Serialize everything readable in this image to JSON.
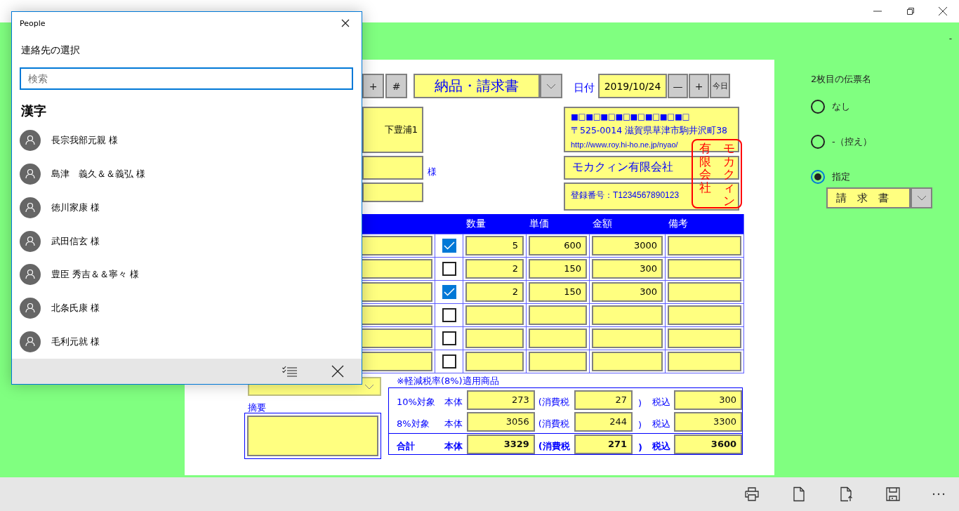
{
  "header_mark": "-",
  "sheet": {
    "toolbar": {
      "left_buttons": [
        "+",
        "#"
      ],
      "slip_type": "納品・請求書",
      "date_label": "日付",
      "date": "2019/10/24",
      "date_buttons": [
        "—",
        "+",
        "今日"
      ]
    },
    "customer": {
      "address": "下豊浦1",
      "honorific": "様"
    },
    "issuer": {
      "pattern": "■□■□■□■□■□■□■□■□",
      "address": "〒525-0014 滋賀県草津市駒井沢町38",
      "url": "http://www.roy.hi-ho.ne.jp/nyao/",
      "company": "モカクィン有限会社",
      "registration": "登録番号：T1234567890123"
    },
    "stamp": {
      "columns": [
        "有限会社",
        "モカクィン"
      ]
    },
    "table": {
      "columns": [
        "数量",
        "単価",
        "金額",
        "備考"
      ],
      "rows": [
        {
          "reduced": true,
          "qty": "5",
          "price": "600",
          "amount": "3000"
        },
        {
          "reduced": false,
          "qty": "2",
          "price": "150",
          "amount": "300"
        },
        {
          "reduced": true,
          "qty": "2",
          "price": "150",
          "amount": "300"
        },
        {
          "reduced": false
        },
        {
          "reduced": false
        },
        {
          "reduced": false
        }
      ]
    },
    "note": "※軽減税率(8%)適用商品",
    "memo_label": "摘要",
    "totals": [
      {
        "kind": "normal",
        "label": "10%対象",
        "body_label": "本体",
        "body": "273",
        "tax_label": "(消費税",
        "tax": "27",
        "close": ")",
        "incl_label": "税込",
        "incl": "300"
      },
      {
        "kind": "normal",
        "label": "8%対象",
        "body_label": "本体",
        "body": "3056",
        "tax_label": "(消費税",
        "tax": "244",
        "close": ")",
        "incl_label": "税込",
        "incl": "3300"
      },
      {
        "kind": "total",
        "label": "合計",
        "body_label": "本体",
        "body": "3329",
        "tax_label": "(消費税",
        "tax": "271",
        "close": ")",
        "incl_label": "税込",
        "incl": "3600"
      }
    ]
  },
  "side": {
    "title": "2枚目の伝票名",
    "options": [
      {
        "label": "なし",
        "selected": false
      },
      {
        "label": "-（控え）",
        "selected": false
      },
      {
        "label": "指定",
        "selected": true
      }
    ],
    "select_value": "請　求　書"
  },
  "dialog": {
    "title": "People",
    "heading": "連絡先の選択",
    "search": {
      "placeholder": "検索"
    },
    "group": "漢字",
    "contacts": [
      "長宗我部元親 様",
      "島津　義久＆＆義弘 様",
      "徳川家康 様",
      "武田信玄 様",
      "豊臣 秀吉＆＆寧々 様",
      "北条氏康 様",
      "毛利元就 様"
    ]
  }
}
